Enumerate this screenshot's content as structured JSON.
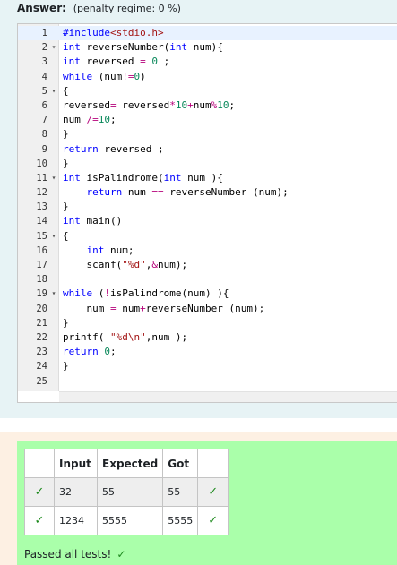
{
  "answer": {
    "label": "Answer:",
    "regime": "(penalty regime: 0 %)"
  },
  "editor": {
    "active_line": 1,
    "lines": [
      {
        "n": "1",
        "fold": "",
        "code": "#include<stdio.h>"
      },
      {
        "n": "2",
        "fold": "▾",
        "code": "int reverseNumber(int num){"
      },
      {
        "n": "3",
        "fold": "",
        "code": "int reversed = 0 ;"
      },
      {
        "n": "4",
        "fold": "",
        "code": "while (num!=0)"
      },
      {
        "n": "5",
        "fold": "▾",
        "code": "{"
      },
      {
        "n": "6",
        "fold": "",
        "code": "reversed= reversed*10+num%10;"
      },
      {
        "n": "7",
        "fold": "",
        "code": "num /=10;"
      },
      {
        "n": "8",
        "fold": "",
        "code": "}"
      },
      {
        "n": "9",
        "fold": "",
        "code": "return reversed ;"
      },
      {
        "n": "10",
        "fold": "",
        "code": "}"
      },
      {
        "n": "11",
        "fold": "▾",
        "code": "int isPalindrome(int num ){"
      },
      {
        "n": "12",
        "fold": "",
        "code": "    return num == reverseNumber (num);"
      },
      {
        "n": "13",
        "fold": "",
        "code": "}"
      },
      {
        "n": "14",
        "fold": "",
        "code": "int main()"
      },
      {
        "n": "15",
        "fold": "▾",
        "code": "{"
      },
      {
        "n": "16",
        "fold": "",
        "code": "    int num;"
      },
      {
        "n": "17",
        "fold": "",
        "code": "    scanf(\"%d\",&num);"
      },
      {
        "n": "18",
        "fold": "",
        "code": ""
      },
      {
        "n": "19",
        "fold": "▾",
        "code": "while (!isPalindrome(num) ){"
      },
      {
        "n": "20",
        "fold": "",
        "code": "    num = num+reverseNumber (num);"
      },
      {
        "n": "21",
        "fold": "",
        "code": "}"
      },
      {
        "n": "22",
        "fold": "",
        "code": "printf( \"%d\\n\",num );"
      },
      {
        "n": "23",
        "fold": "",
        "code": "return 0;"
      },
      {
        "n": "24",
        "fold": "",
        "code": "}"
      },
      {
        "n": "25",
        "fold": "",
        "code": ""
      }
    ]
  },
  "results": {
    "headers": [
      "",
      "Input",
      "Expected",
      "Got",
      ""
    ],
    "rows": [
      {
        "pass_icon": "✓",
        "input": "32",
        "expected": "55",
        "got": "55",
        "got_icon": "✓"
      },
      {
        "pass_icon": "✓",
        "input": "1234",
        "expected": "5555",
        "got": "5555",
        "got_icon": "✓"
      }
    ],
    "summary": "Passed all tests!",
    "summary_icon": "✓"
  },
  "colors": {
    "answer_bg": "#e7f3f5",
    "result_outer_bg": "#fdf0e3",
    "result_inner_bg": "#aaffaa",
    "pass_green": "#1e8a1e",
    "keyword_blue": "#0000ff",
    "string_red": "#a31515"
  },
  "icons": {
    "pass": "check-icon",
    "fold": "fold-arrow-icon"
  }
}
